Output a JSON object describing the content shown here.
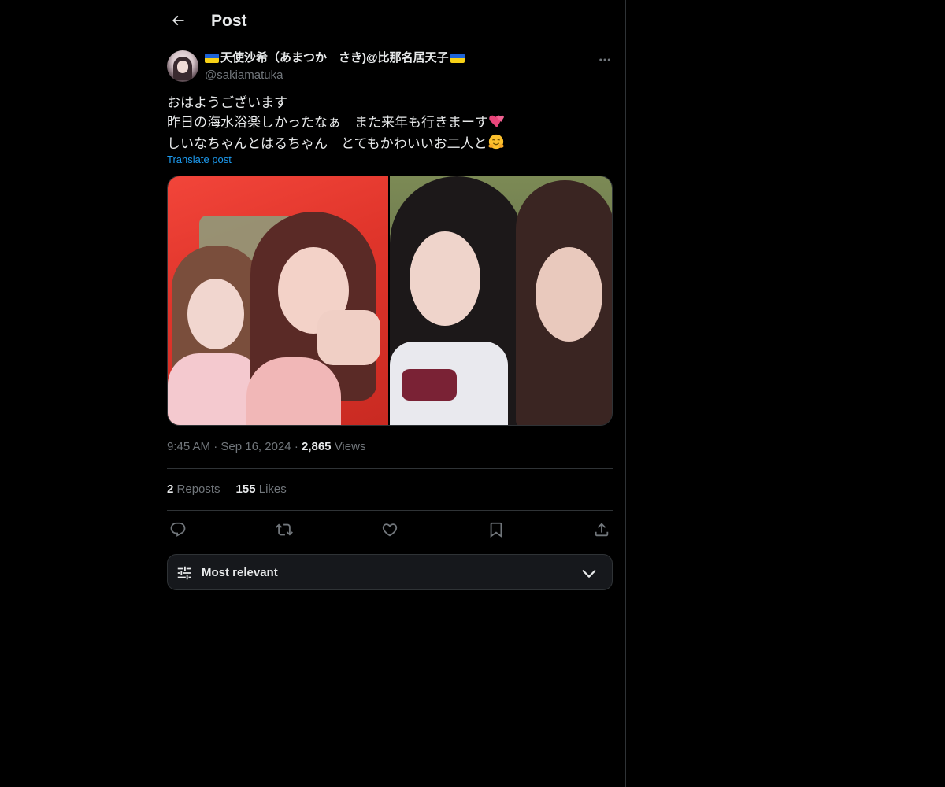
{
  "header": {
    "title": "Post"
  },
  "author": {
    "display_name": "天使沙希（あまつか　さき)@比那名居天子",
    "handle": "@sakiamatuka",
    "flag_colors": [
      "#1d63d6",
      "#f7d117"
    ]
  },
  "tweet": {
    "lines": [
      "おはようございます",
      "昨日の海水浴楽しかったなぁ　また来年も行きまーす",
      "しいなちゃんとはるちゃん　とてもかわいいお二人と"
    ],
    "translate_label": "Translate post",
    "time": "9:45 AM",
    "date": "Sep 16, 2024",
    "views_count": "2,865",
    "views_label": "Views"
  },
  "stats": {
    "reposts_count": "2",
    "reposts_label": "Reposts",
    "likes_count": "155",
    "likes_label": "Likes"
  },
  "sort": {
    "label": "Most relevant"
  },
  "colors": {
    "background": "#000000",
    "text": "#e7e9ea",
    "muted": "#71767b",
    "link": "#1d9bf0",
    "border": "#2f3336"
  },
  "icons": [
    "back-arrow-icon",
    "more-icon",
    "heart-emoji-icon",
    "hug-emoji-icon",
    "reply-icon",
    "repost-icon",
    "like-icon",
    "bookmark-icon",
    "share-icon",
    "sliders-icon",
    "chevron-down-icon"
  ]
}
